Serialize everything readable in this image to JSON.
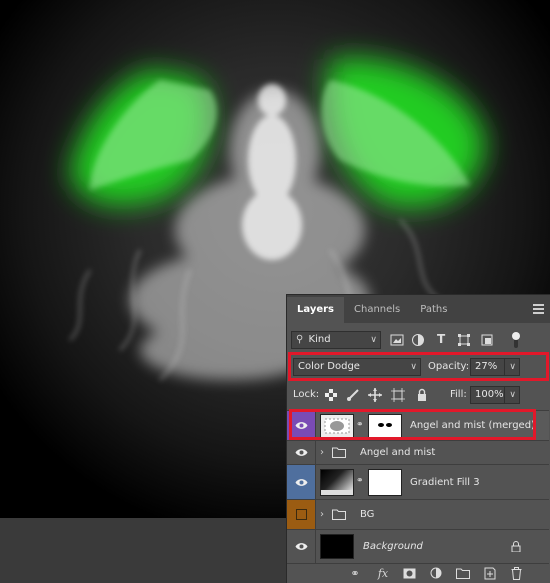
{
  "tabs": [
    "Layers",
    "Channels",
    "Paths"
  ],
  "filter": {
    "kind_label": "Kind"
  },
  "blend": {
    "mode": "Color Dodge",
    "opacity_label": "Opacity:",
    "opacity_value": "27%"
  },
  "lock": {
    "label": "Lock:",
    "fill_label": "Fill:",
    "fill_value": "100%"
  },
  "layers": [
    {
      "name": "Angel and mist (merged)",
      "visible": true,
      "selected": true
    },
    {
      "name": "Angel and mist",
      "visible": true,
      "group": true
    },
    {
      "name": "Gradient Fill 3",
      "visible": true
    },
    {
      "name": "BG",
      "visible": false,
      "group": true
    },
    {
      "name": "Background",
      "visible": true,
      "locked": true
    }
  ],
  "footer_icons": [
    "link-icon",
    "fx-icon",
    "mask-icon",
    "adjustment-icon",
    "new-group-icon",
    "new-layer-icon",
    "trash-icon"
  ],
  "colors": {
    "panel": "#535353",
    "highlight": "#e2182a",
    "glow": "#22cc22",
    "selected_eye_bg": "#7a4bb5",
    "gradient_eye_bg": "#4f6f9e",
    "bg_eye_bg": "#9b5c12"
  }
}
